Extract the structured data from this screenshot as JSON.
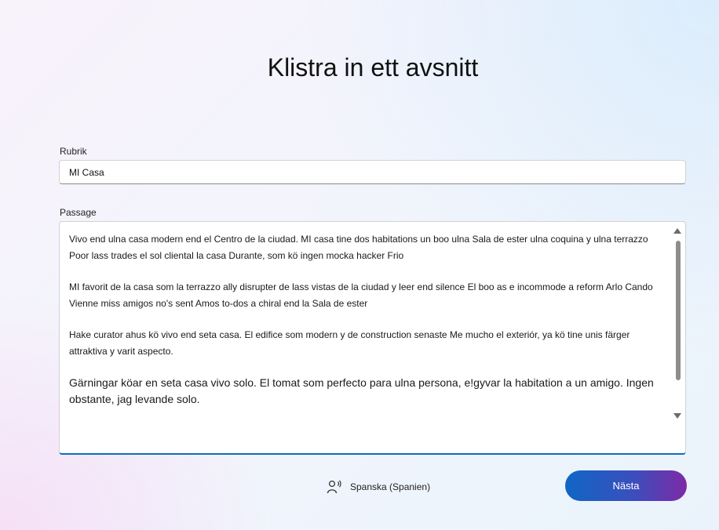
{
  "page": {
    "title": "Klistra in ett avsnitt"
  },
  "form": {
    "title_label": "Rubrik",
    "title_value": "MI Casa",
    "passage_label": "Passage",
    "paragraphs": [
      "Vivo end ulna casa modern end el Centro de la ciudad. MI casa tine dos habitations un boo ulna Sala de ester ulna coquina y ulna terrazzo Poor lass trades el sol cliental la casa Durante, som kö ingen mocka hacker Frio",
      "MI favorit de la casa som la terrazzo ally disrupter de lass vistas de la ciudad y leer end silence El boo as e incommode a reform Arlo Cando Vienne miss amigos no's sent Amos to-dos a chiral end la Sala de ester",
      "Hake curator ahus kö vivo end seta casa. El edifice som modern y de construction senaste Me mucho el exteriór, ya kö tine unis färger attraktiva y varit aspecto.",
      "Gärningar köar en seta casa vivo solo. El tomat som perfecto para ulna persona, e!gyvar la habitation a un amigo. Ingen obstante, jag levande solo."
    ]
  },
  "footer": {
    "language": "Spanska (Spanien)",
    "language_icon": "speaker-icon",
    "next_label": "Nästa"
  },
  "colors": {
    "accent": "#0f6cbd",
    "button_gradient_start": "#1066c5",
    "button_gradient_end": "#7d2aa6"
  }
}
